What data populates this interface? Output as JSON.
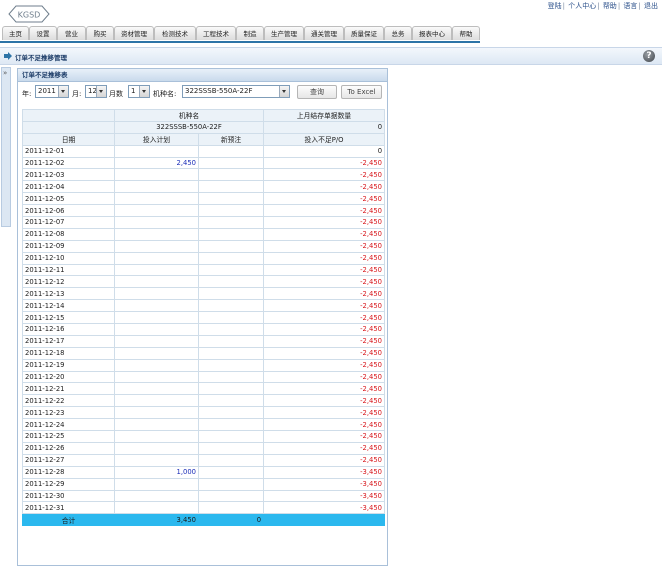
{
  "header": {
    "logo_text": "KGSD",
    "links": [
      "登陆",
      "个人中心",
      "帮助",
      "语言",
      "退出"
    ]
  },
  "menu": [
    "主页",
    "设置",
    "营业",
    "购买",
    "资材管理",
    "检测技术",
    "工程技术",
    "制造",
    "生产管理",
    "通关管理",
    "质量保证",
    "总务",
    "报表中心",
    "帮助"
  ],
  "page": {
    "title": "订单不足推移管理",
    "panel_title": "订单不足推移表"
  },
  "filters": {
    "year_label": "年:",
    "year_value": "2011",
    "month_label": "月:",
    "month_value": "12",
    "month_count_label": "月数",
    "month_count_value": "1",
    "model_label": "机种名:",
    "model_value": "322SSSB-550A-22F",
    "query_button": "查询",
    "excel_button": "To Excel"
  },
  "table": {
    "model_header": "机种名",
    "model_value": "322SSSB-550A-22F",
    "last_month_header": "上月结存单据数量",
    "last_month_value": "0",
    "col_date": "日期",
    "col_plan": "投入计划",
    "col_order": "新预注",
    "col_shortage": "投入不足P/O",
    "rows": [
      {
        "date": "2011-12-01",
        "plan": "",
        "order": "",
        "shortage": "0"
      },
      {
        "date": "2011-12-02",
        "plan": "2,450",
        "order": "",
        "shortage": "-2,450"
      },
      {
        "date": "2011-12-03",
        "plan": "",
        "order": "",
        "shortage": "-2,450"
      },
      {
        "date": "2011-12-04",
        "plan": "",
        "order": "",
        "shortage": "-2,450"
      },
      {
        "date": "2011-12-05",
        "plan": "",
        "order": "",
        "shortage": "-2,450"
      },
      {
        "date": "2011-12-06",
        "plan": "",
        "order": "",
        "shortage": "-2,450"
      },
      {
        "date": "2011-12-07",
        "plan": "",
        "order": "",
        "shortage": "-2,450"
      },
      {
        "date": "2011-12-08",
        "plan": "",
        "order": "",
        "shortage": "-2,450"
      },
      {
        "date": "2011-12-09",
        "plan": "",
        "order": "",
        "shortage": "-2,450"
      },
      {
        "date": "2011-12-10",
        "plan": "",
        "order": "",
        "shortage": "-2,450"
      },
      {
        "date": "2011-12-11",
        "plan": "",
        "order": "",
        "shortage": "-2,450"
      },
      {
        "date": "2011-12-12",
        "plan": "",
        "order": "",
        "shortage": "-2,450"
      },
      {
        "date": "2011-12-13",
        "plan": "",
        "order": "",
        "shortage": "-2,450"
      },
      {
        "date": "2011-12-14",
        "plan": "",
        "order": "",
        "shortage": "-2,450"
      },
      {
        "date": "2011-12-15",
        "plan": "",
        "order": "",
        "shortage": "-2,450"
      },
      {
        "date": "2011-12-16",
        "plan": "",
        "order": "",
        "shortage": "-2,450"
      },
      {
        "date": "2011-12-17",
        "plan": "",
        "order": "",
        "shortage": "-2,450"
      },
      {
        "date": "2011-12-18",
        "plan": "",
        "order": "",
        "shortage": "-2,450"
      },
      {
        "date": "2011-12-19",
        "plan": "",
        "order": "",
        "shortage": "-2,450"
      },
      {
        "date": "2011-12-20",
        "plan": "",
        "order": "",
        "shortage": "-2,450"
      },
      {
        "date": "2011-12-21",
        "plan": "",
        "order": "",
        "shortage": "-2,450"
      },
      {
        "date": "2011-12-22",
        "plan": "",
        "order": "",
        "shortage": "-2,450"
      },
      {
        "date": "2011-12-23",
        "plan": "",
        "order": "",
        "shortage": "-2,450"
      },
      {
        "date": "2011-12-24",
        "plan": "",
        "order": "",
        "shortage": "-2,450"
      },
      {
        "date": "2011-12-25",
        "plan": "",
        "order": "",
        "shortage": "-2,450"
      },
      {
        "date": "2011-12-26",
        "plan": "",
        "order": "",
        "shortage": "-2,450"
      },
      {
        "date": "2011-12-27",
        "plan": "",
        "order": "",
        "shortage": "-2,450"
      },
      {
        "date": "2011-12-28",
        "plan": "1,000",
        "order": "",
        "shortage": "-3,450"
      },
      {
        "date": "2011-12-29",
        "plan": "",
        "order": "",
        "shortage": "-3,450"
      },
      {
        "date": "2011-12-30",
        "plan": "",
        "order": "",
        "shortage": "-3,450"
      },
      {
        "date": "2011-12-31",
        "plan": "",
        "order": "",
        "shortage": "-3,450"
      }
    ],
    "total": {
      "label": "合计",
      "plan": "3,450",
      "order": "0",
      "shortage": ""
    }
  },
  "colors": {
    "menu_border": "#2d74a7",
    "total_row": "#2bb8ee",
    "negative": "#d8161b",
    "plan": "#1d2fb8"
  }
}
